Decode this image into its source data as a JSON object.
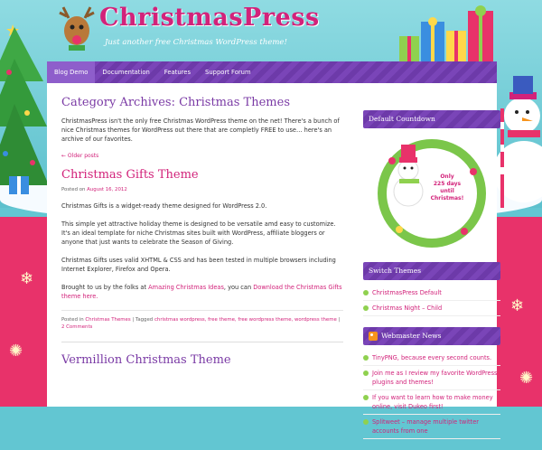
{
  "site": {
    "title": "ChristmasPress",
    "tagline": "Just another free Christmas WordPress theme!"
  },
  "nav": {
    "items": [
      {
        "label": "Blog Demo",
        "active": true
      },
      {
        "label": "Documentation",
        "active": false
      },
      {
        "label": "Features",
        "active": false
      },
      {
        "label": "Support Forum",
        "active": false
      }
    ]
  },
  "archive": {
    "title": "Category Archives: Christmas Themes",
    "description": "ChristmasPress isn't the only free Christmas WordPress theme on the net! There's a bunch of nice Christmas themes for WordPress out there that are completly FREE to use… here's an archive of our favorites.",
    "older_posts": "← Older posts"
  },
  "post": {
    "title": "Christmas Gifts Theme",
    "posted_on_label": "Posted on",
    "date": "August 16, 2012",
    "p1": "Christmas Gifts is a widget-ready theme designed for WordPress 2.0.",
    "p2": "This simple yet attractive holiday theme is designed to be versatile amd easy to customize. It's an ideal template for niche Christmas sites built with WordPress, affiliate bloggers or anyone that just wants to celebrate the Season of Giving.",
    "p3": "Christmas Gifts uses valid XHTML & CSS and has been tested in multiple browsers including Internet Explorer, Firefox and Opera.",
    "p4_prefix": "Brought to us by the folks at",
    "p4_link1": "Amazing Christmas Ideas",
    "p4_mid": ", you can",
    "p4_link2": "Download the Christmas Gifts theme here.",
    "posted_in_label": "Posted in",
    "category": "Christmas Themes",
    "tagged_label": "| Tagged",
    "tags": "christmas wordpress, free theme, free wordpress theme, wordpress theme",
    "comments": "2 Comments"
  },
  "next_post": {
    "title": "Vermillion Christmas Theme"
  },
  "sidebar": {
    "countdown_title": "Default Countdown",
    "countdown_line1": "Only",
    "countdown_line2": "225 days",
    "countdown_line3": "until",
    "countdown_line4": "Christmas!",
    "switch_title": "Switch Themes",
    "switch_items": [
      "ChristmasPress Default",
      "Christmas Night – Child"
    ],
    "news_title": "Webmaster News",
    "news_items": [
      "TinyPNG, because every second counts.",
      "Join me as I review my favorite WordPress plugins and themes!",
      "If you want to learn how to make money online, visit Dukeo first!",
      "Splitweet – manage multiple twitter accounts from one"
    ]
  },
  "colors": {
    "accent": "#d2227a",
    "nav_purple": "#7a45b8",
    "heading_purple": "#7a3aa5",
    "sky": "#62c6d2",
    "red_bg": "#e8326a"
  }
}
